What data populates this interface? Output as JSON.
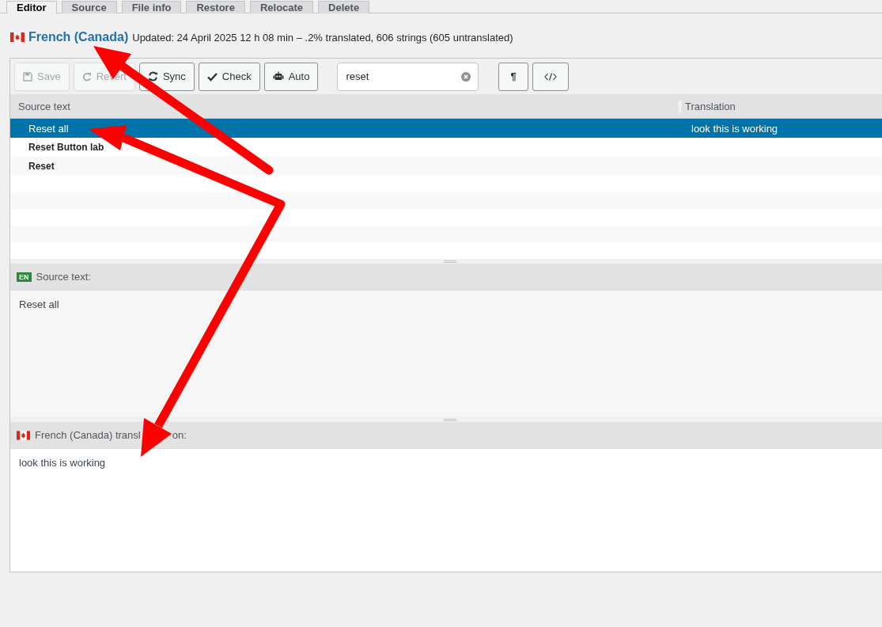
{
  "tabs": [
    {
      "label": "Editor",
      "selected": true
    },
    {
      "label": "Source",
      "selected": false
    },
    {
      "label": "File info",
      "selected": false
    },
    {
      "label": "Restore",
      "selected": false
    },
    {
      "label": "Relocate",
      "selected": false
    },
    {
      "label": "Delete",
      "selected": false
    }
  ],
  "header": {
    "language": "French (Canada)",
    "status": "Updated: 24 April 2025 12 h 08 min – .2% translated, 606 strings (605 untranslated)"
  },
  "toolbar": {
    "buttons": [
      {
        "label": "Save",
        "kind": "save",
        "disabled": true
      },
      {
        "label": "Revert",
        "kind": "revert",
        "disabled": true
      },
      {
        "label": "Sync",
        "kind": "sync",
        "disabled": false
      },
      {
        "label": "Check",
        "kind": "check",
        "disabled": false
      },
      {
        "label": "Auto",
        "kind": "auto",
        "disabled": false
      }
    ],
    "search": {
      "value": "reset"
    },
    "tools": [
      {
        "label": "¶",
        "kind": "text"
      },
      {
        "kind": "code"
      }
    ]
  },
  "table": {
    "columns": [
      "Source text",
      "Translation"
    ],
    "rows": [
      {
        "source": "Reset all",
        "translation": "look this is working",
        "selected": true,
        "untranslated": false
      },
      {
        "source": "Reset Button lab",
        "selected": false,
        "untranslated": true
      },
      {
        "source": "Reset",
        "selected": false,
        "untranslated": true
      }
    ]
  },
  "source_panel": {
    "badge": "EN",
    "label": "Source text:",
    "text": "Reset all"
  },
  "translation_panel": {
    "label": "French (Canada) transl",
    "label_tail": "on:",
    "text": "look this is working"
  }
}
